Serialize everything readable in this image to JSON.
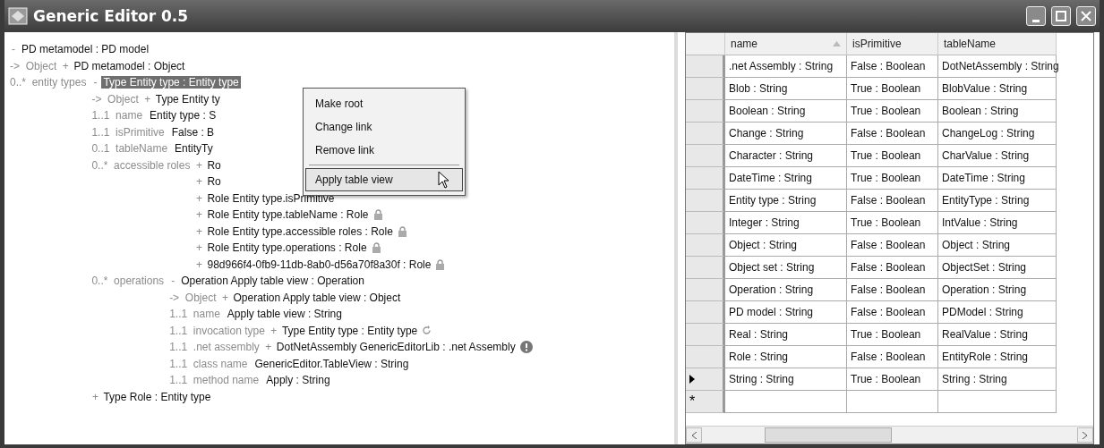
{
  "window": {
    "title": "Generic Editor 0.5"
  },
  "tree": {
    "toggle": "-",
    "text": "PD metamodel : PD model",
    "selected": false,
    "children": [
      {
        "multiplicity": "->",
        "role": "Object",
        "values": [
          {
            "toggle": "+",
            "text": "PD metamodel : Object",
            "selected": false
          }
        ]
      },
      {
        "multiplicity": "0..*",
        "role": "entity types",
        "values": [
          {
            "toggle": "-",
            "text": "Type Entity type : Entity type",
            "selected": true,
            "children": [
              {
                "multiplicity": "->",
                "role": "Object",
                "values": [
                  {
                    "toggle": "+",
                    "text": "Type Entity ty",
                    "selected": false
                  }
                ]
              },
              {
                "multiplicity": "1..1",
                "role": "name",
                "values": [
                  {
                    "text": "Entity type : S",
                    "selected": false
                  }
                ]
              },
              {
                "multiplicity": "1..1",
                "role": "isPrimitive",
                "values": [
                  {
                    "text": "False : B",
                    "selected": false
                  }
                ]
              },
              {
                "multiplicity": "0..1",
                "role": "tableName",
                "values": [
                  {
                    "text": "EntityTy",
                    "selected": false
                  }
                ]
              },
              {
                "multiplicity": "0..*",
                "role": "accessible roles",
                "values": [
                  {
                    "toggle": "+",
                    "text": "Ro",
                    "selected": false
                  },
                  {
                    "toggle": "+",
                    "text": "Ro",
                    "selected": false
                  },
                  {
                    "toggle": "+",
                    "text": "Role Entity type.isPrimitive",
                    "selected": false
                  },
                  {
                    "toggle": "+",
                    "text": "Role Entity type.tableName : Role",
                    "locked": true,
                    "selected": false
                  },
                  {
                    "toggle": "+",
                    "text": "Role Entity type.accessible roles : Role",
                    "locked": true,
                    "selected": false
                  },
                  {
                    "toggle": "+",
                    "text": "Role Entity type.operations : Role",
                    "locked": true,
                    "selected": false
                  },
                  {
                    "toggle": "+",
                    "text": "98d966f4-0fb9-11db-8ab0-d56a70f8a30f : Role",
                    "locked": true,
                    "selected": false
                  }
                ]
              },
              {
                "multiplicity": "0..*",
                "role": "operations",
                "values": [
                  {
                    "toggle": "-",
                    "text": "Operation Apply table view : Operation",
                    "selected": false,
                    "children": [
                      {
                        "multiplicity": "->",
                        "role": "Object",
                        "values": [
                          {
                            "toggle": "+",
                            "text": "Operation Apply table view : Object",
                            "selected": false
                          }
                        ]
                      },
                      {
                        "multiplicity": "1..1",
                        "role": "name",
                        "values": [
                          {
                            "text": "Apply table view : String",
                            "selected": false
                          }
                        ]
                      },
                      {
                        "multiplicity": "1..1",
                        "role": "invocation type",
                        "values": [
                          {
                            "toggle": "+",
                            "text": "Type Entity type : Entity type",
                            "cyclic": true,
                            "selected": false
                          }
                        ]
                      },
                      {
                        "multiplicity": "1..1",
                        "role": ".net assembly",
                        "values": [
                          {
                            "toggle": "+",
                            "text": "DotNetAssembly GenericEditorLib : .net Assembly",
                            "warning": true,
                            "selected": false
                          }
                        ]
                      },
                      {
                        "multiplicity": "1..1",
                        "role": "class name",
                        "values": [
                          {
                            "text": "GenericEditor.TableView : String",
                            "selected": false
                          }
                        ]
                      },
                      {
                        "multiplicity": "1..1",
                        "role": "method name",
                        "values": [
                          {
                            "text": "Apply : String",
                            "selected": false
                          }
                        ]
                      }
                    ]
                  }
                ]
              }
            ]
          },
          {
            "toggle": "+",
            "text": "Type Role : Entity type",
            "selected": false
          }
        ]
      }
    ]
  },
  "context_menu": {
    "items": [
      {
        "kind": "item",
        "label": "Make root",
        "selected": false
      },
      {
        "kind": "item",
        "label": "Change link",
        "selected": false
      },
      {
        "kind": "item",
        "label": "Remove link",
        "selected": false
      },
      {
        "kind": "separator"
      },
      {
        "kind": "item",
        "label": "Apply table view",
        "selected": true
      }
    ]
  },
  "table": {
    "columns": [
      {
        "label": "name",
        "sorted": true
      },
      {
        "label": "isPrimitive",
        "sorted": false
      },
      {
        "label": "tableName",
        "sorted": false
      }
    ],
    "rows": [
      {
        "cells": [
          ".net Assembly : String",
          "False : Boolean",
          "DotNetAssembly : String"
        ],
        "current": false
      },
      {
        "cells": [
          "Blob : String",
          "True : Boolean",
          "BlobValue : String"
        ],
        "current": false
      },
      {
        "cells": [
          "Boolean : String",
          "True : Boolean",
          "Boolean : String"
        ],
        "current": false
      },
      {
        "cells": [
          "Change : String",
          "False : Boolean",
          "ChangeLog : String"
        ],
        "current": false
      },
      {
        "cells": [
          "Character : String",
          "True : Boolean",
          "CharValue : String"
        ],
        "current": false
      },
      {
        "cells": [
          "DateTime : String",
          "True : Boolean",
          "DateTime : String"
        ],
        "current": false
      },
      {
        "cells": [
          "Entity type : String",
          "False : Boolean",
          "EntityType : String"
        ],
        "current": false
      },
      {
        "cells": [
          "Integer : String",
          "True : Boolean",
          "IntValue : String"
        ],
        "current": false
      },
      {
        "cells": [
          "Object : String",
          "False : Boolean",
          "Object : String"
        ],
        "current": false
      },
      {
        "cells": [
          "Object set : String",
          "False : Boolean",
          "ObjectSet : String"
        ],
        "current": false
      },
      {
        "cells": [
          "Operation : String",
          "False : Boolean",
          "Operation : String"
        ],
        "current": false
      },
      {
        "cells": [
          "PD model : String",
          "False : Boolean",
          "PDModel : String"
        ],
        "current": false
      },
      {
        "cells": [
          "Real : String",
          "True : Boolean",
          "RealValue : String"
        ],
        "current": false
      },
      {
        "cells": [
          "Role : String",
          "False : Boolean",
          "EntityRole : String"
        ],
        "current": false
      },
      {
        "cells": [
          "String : String",
          "True : Boolean",
          "String : String"
        ],
        "current": true
      }
    ],
    "new_row_marker": "*"
  }
}
